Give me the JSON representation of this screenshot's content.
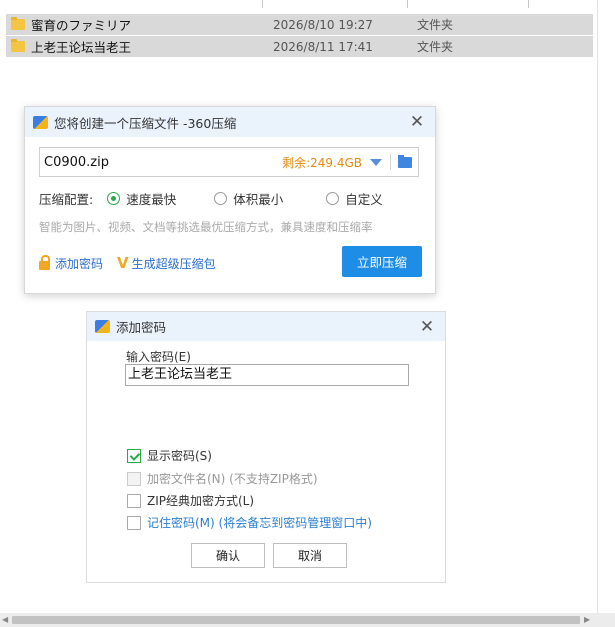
{
  "explorer": {
    "files": [
      {
        "name": "蜜育のファミリア",
        "date": "2026/8/10 19:27",
        "type": "文件夹"
      },
      {
        "name": "上老王论坛当老王",
        "date": "2026/8/11 17:41",
        "type": "文件夹"
      }
    ]
  },
  "compress_dialog": {
    "title": "您将创建一个压缩文件 -360压缩",
    "filename": "C0900.zip",
    "space_left": "剩余:249.4GB",
    "option_label": "压缩配置:",
    "options": [
      "速度最快",
      "体积最小",
      "自定义"
    ],
    "selected_option": "速度最快",
    "hint": "智能为图片、视频、文档等挑选最优压缩方式，兼具速度和压缩率",
    "add_password_link": "添加密码",
    "super_package_link": "生成超级压缩包",
    "compress_button": "立即压缩",
    "close": "✕"
  },
  "password_dialog": {
    "title": "添加密码",
    "input_label": "输入密码(E)",
    "password_value": "上老王论坛当老王",
    "show_password": "显示密码(S)",
    "encrypt_filename": "加密文件名(N) (不支持ZIP格式)",
    "zip_classic": "ZIP经典加密方式(L)",
    "remember_password": "记住密码(M) (将会备忘到密码管理窗口中)",
    "ok_button": "确认",
    "cancel_button": "取消",
    "close": "✕"
  },
  "colors": {
    "accent": "#1e8de6",
    "check": "#2aa84a",
    "link": "#2b6fcc",
    "space_left": "#e8890c"
  }
}
